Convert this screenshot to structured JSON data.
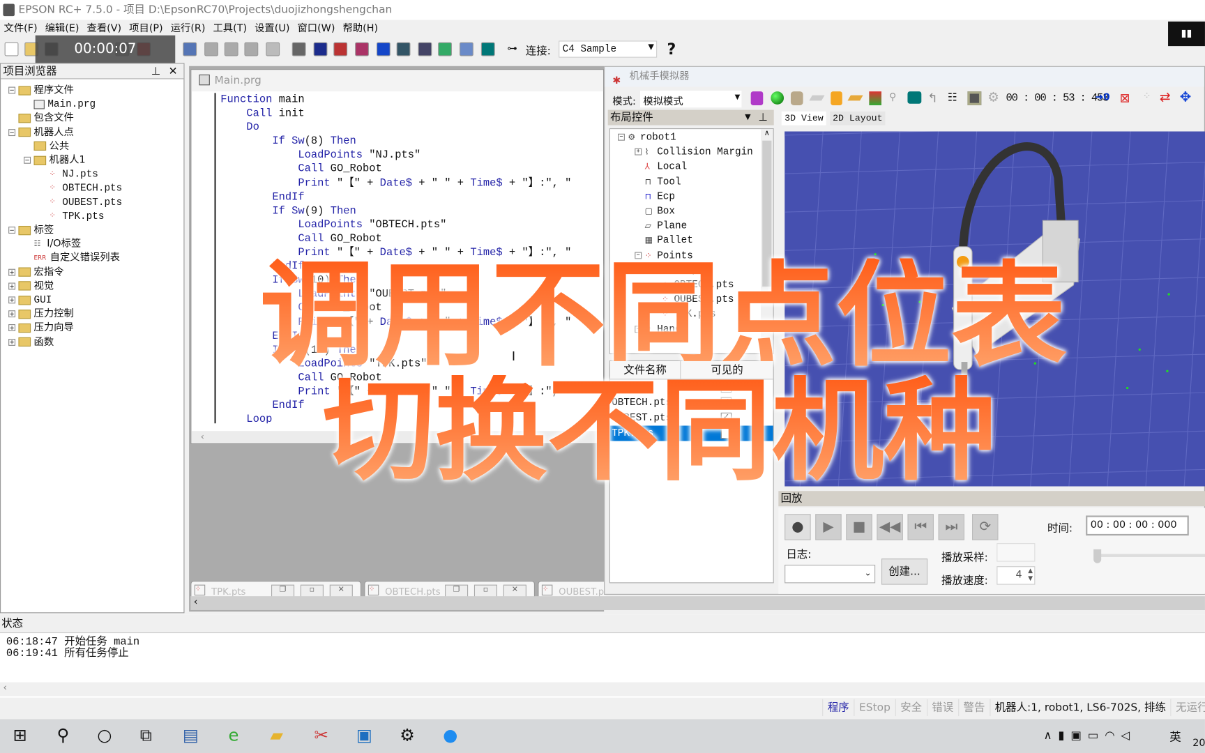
{
  "window": {
    "title": "EPSON RC+ 7.5.0 - 项目 D:\\EpsonRC70\\Projects\\duojizhongshengchan"
  },
  "menu": [
    "文件(F)",
    "编辑(E)",
    "查看(V)",
    "项目(P)",
    "运行(R)",
    "工具(T)",
    "设置(U)",
    "窗口(W)",
    "帮助(H)"
  ],
  "recording": {
    "timer": "00:00:07"
  },
  "toolbar": {
    "connect_label": "连接:",
    "connect_value": "C4 Sample",
    "help": "?"
  },
  "project_browser": {
    "title": "项目浏览器",
    "items": [
      {
        "label": "程序文件",
        "level": 0,
        "type": "folder",
        "expanded": true
      },
      {
        "label": "Main.prg",
        "level": 1,
        "type": "prg"
      },
      {
        "label": "包含文件",
        "level": 0,
        "type": "folder"
      },
      {
        "label": "机器人点",
        "level": 0,
        "type": "folder",
        "expanded": true
      },
      {
        "label": "公共",
        "level": 1,
        "type": "folder"
      },
      {
        "label": "机器人1",
        "level": 1,
        "type": "folder",
        "expanded": true
      },
      {
        "label": "NJ.pts",
        "level": 2,
        "type": "pts"
      },
      {
        "label": "OBTECH.pts",
        "level": 2,
        "type": "pts"
      },
      {
        "label": "OUBEST.pts",
        "level": 2,
        "type": "pts"
      },
      {
        "label": "TPK.pts",
        "level": 2,
        "type": "pts"
      },
      {
        "label": "标签",
        "level": 0,
        "type": "folder",
        "expanded": true
      },
      {
        "label": "I/O标签",
        "level": 1,
        "type": "io"
      },
      {
        "label": "自定义错误列表",
        "level": 1,
        "type": "err"
      },
      {
        "label": "宏指令",
        "level": 0,
        "type": "folder",
        "collapsed": true
      },
      {
        "label": "视觉",
        "level": 0,
        "type": "folder",
        "collapsed": true
      },
      {
        "label": "GUI",
        "level": 0,
        "type": "folder",
        "collapsed": true
      },
      {
        "label": "压力控制",
        "level": 0,
        "type": "folder",
        "collapsed": true
      },
      {
        "label": "压力向导",
        "level": 0,
        "type": "folder",
        "collapsed": true
      },
      {
        "label": "函数",
        "level": 0,
        "type": "folder",
        "collapsed": true
      }
    ]
  },
  "editor": {
    "title": "Main.prg",
    "lines": [
      "Function main",
      "    Call init",
      "    Do",
      "        If Sw(8) Then",
      "            LoadPoints \"NJ.pts\"",
      "            Call GO_Robot",
      "            Print \"【\" + Date$ + \" \" + Time$ + \"】:\", \"",
      "        EndIf",
      "        If Sw(9) Then",
      "            LoadPoints \"OBTECH.pts\"",
      "            Call GO_Robot",
      "            Print \"【\" + Date$ + \" \" + Time$ + \"】:\", \"",
      "        EndIf",
      "        If Sw(10) Then",
      "            LoadPoints \"OUBEST.pts\"",
      "            Call GO_Robot",
      "            Print \"【\" + Date$ + \" \" + Time$ + \"】:\", \"",
      "        EndIf",
      "        If Sw(11) Then",
      "            LoadPoints \"TPK.pts\"",
      "            Call GO_Robot",
      "            Print \"【\" + Date$ + \" \" + Time$ + \"】:\", \"",
      "        EndIf",
      "    Loop"
    ]
  },
  "doc_tabs": [
    "TPK.pts",
    "OBTECH.pts",
    "OUBEST.pts"
  ],
  "simulator": {
    "title": "机械手模拟器",
    "mode_label": "模式:",
    "mode_value": "模拟模式",
    "clock": "00 : 00 : 53 : 453",
    "counter": "0",
    "layout_title": "布局控件",
    "tree": [
      {
        "label": "robot1",
        "level": 0
      },
      {
        "label": "Collision Margin",
        "level": 1
      },
      {
        "label": "Local",
        "level": 1
      },
      {
        "label": "Tool",
        "level": 1
      },
      {
        "label": "Ecp",
        "level": 1
      },
      {
        "label": "Box",
        "level": 1
      },
      {
        "label": "Plane",
        "level": 1
      },
      {
        "label": "Pallet",
        "level": 1
      },
      {
        "label": "Points",
        "level": 1
      },
      {
        "label": "NJ.pts",
        "level": 2
      },
      {
        "label": "OBTECH.pts",
        "level": 2
      },
      {
        "label": "OUBEST.pts",
        "level": 2
      },
      {
        "label": "TPK.pts",
        "level": 2
      },
      {
        "label": "Hand",
        "level": 1
      }
    ],
    "file_table": {
      "headers": [
        "文件名称",
        "可见的"
      ],
      "rows": [
        {
          "name": "NJ.pts",
          "visible": false
        },
        {
          "name": "OBTECH.pts",
          "visible": true
        },
        {
          "name": "OUBEST.pts",
          "visible": true
        },
        {
          "name": "TPK.pts",
          "visible": false,
          "selected": true
        }
      ]
    },
    "view_tabs": [
      "3D View",
      "2D Layout"
    ],
    "playback": {
      "title": "回放",
      "time_label": "时间:",
      "time_value": "00 : 00 : 00 : 000",
      "log_label": "日志:",
      "create_label": "创建...",
      "sample_label": "播放采样:",
      "speed_label": "播放速度:",
      "speed_value": "4"
    }
  },
  "status_panel": {
    "title": "状态",
    "log": [
      "06:18:47 开始任务 main",
      "06:19:41 所有任务停止"
    ]
  },
  "statusbar": [
    "程序",
    "EStop",
    "安全",
    "错误",
    "警告",
    "机器人:1, robot1, LS6-702S, 排练",
    "无运行中任"
  ],
  "overlay": {
    "line1": "调用不同点位表",
    "line2": "切换不同机种"
  },
  "taskbar": {
    "ime": "英",
    "clock_partial": "20"
  },
  "colors": {
    "accent_blue": "#0a63c9",
    "overlay_orange": "#ff7a33",
    "floor_blue": "#4650b0",
    "selection": "#0078d7"
  }
}
